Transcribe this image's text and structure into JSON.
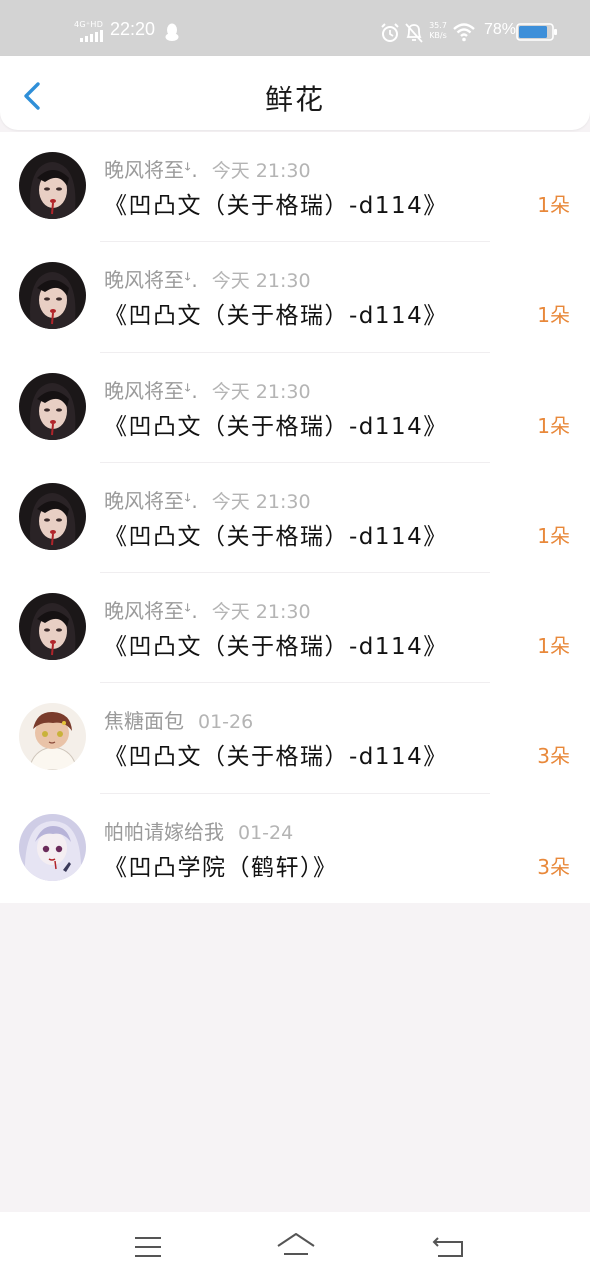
{
  "status_bar": {
    "network": "4G⁺HD",
    "time": "22:20",
    "speed_value": "35.7",
    "speed_unit": "KB/s",
    "battery": "78%"
  },
  "header": {
    "title": "鲜花",
    "back_icon": "chevron-left-icon"
  },
  "items": [
    {
      "name": "晚风将至ꜜ.",
      "time": "今天 21:30",
      "post": "《凹凸文（关于格瑞）-d114》",
      "count": "1朵",
      "avatar": "gothic-girl"
    },
    {
      "name": "晚风将至ꜜ.",
      "time": "今天 21:30",
      "post": "《凹凸文（关于格瑞）-d114》",
      "count": "1朵",
      "avatar": "gothic-girl"
    },
    {
      "name": "晚风将至ꜜ.",
      "time": "今天 21:30",
      "post": "《凹凸文（关于格瑞）-d114》",
      "count": "1朵",
      "avatar": "gothic-girl"
    },
    {
      "name": "晚风将至ꜜ.",
      "time": "今天 21:30",
      "post": "《凹凸文（关于格瑞）-d114》",
      "count": "1朵",
      "avatar": "gothic-girl"
    },
    {
      "name": "晚风将至ꜜ.",
      "time": "今天 21:30",
      "post": "《凹凸文（关于格瑞）-d114》",
      "count": "1朵",
      "avatar": "gothic-girl"
    },
    {
      "name": "焦糖面包",
      "time": "01-26",
      "post": "《凹凸文（关于格瑞）-d114》",
      "count": "3朵",
      "avatar": "chibi-boy"
    },
    {
      "name": "帕帕请嫁给我",
      "time": "01-24",
      "post": "《凹凸学院（鹤轩）》",
      "count": "3朵",
      "avatar": "purple-girl"
    }
  ],
  "colors": {
    "accent_blue": "#2f8fd8",
    "count_orange": "#e8883a",
    "status_bar_bg": "#d3d3d3"
  },
  "nav_bar": {
    "menu_icon": "menu-icon",
    "home_icon": "home-icon",
    "back_icon": "back-arrow-icon"
  }
}
